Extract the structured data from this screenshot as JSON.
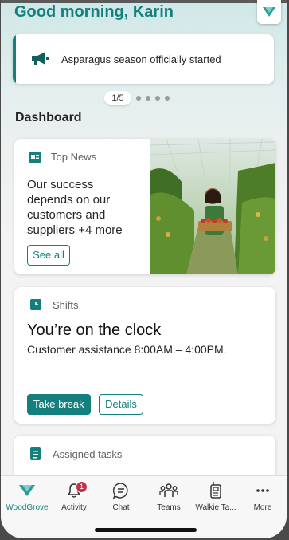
{
  "header": {
    "greeting": "Good morning, Karin",
    "brand_icon": "woodgrove-logo-icon"
  },
  "announcement": {
    "text": "Asparagus season officially started",
    "icon": "megaphone-icon",
    "pager": "1/5"
  },
  "dashboard": {
    "title": "Dashboard",
    "top_news": {
      "label": "Top News",
      "body": "Our success depends on our customers and suppliers +4 more",
      "button": "See all"
    },
    "shifts": {
      "label": "Shifts",
      "title": "You’re on the clock",
      "subtitle": "Customer assistance 8:00AM – 4:00PM.",
      "primary_button": "Take break",
      "secondary_button": "Details"
    },
    "assigned_tasks": {
      "label": "Assigned tasks"
    }
  },
  "nav": {
    "items": [
      {
        "label": "WoodGrove",
        "icon": "woodgrove-icon"
      },
      {
        "label": "Activity",
        "icon": "bell-icon",
        "badge": "1"
      },
      {
        "label": "Chat",
        "icon": "chat-icon"
      },
      {
        "label": "Teams",
        "icon": "teams-icon"
      },
      {
        "label": "Walkie Ta...",
        "icon": "walkie-talkie-icon"
      },
      {
        "label": "More",
        "icon": "more-icon"
      }
    ]
  },
  "colors": {
    "accent": "#13807d",
    "badge": "#c4314b",
    "text": "#242424"
  }
}
